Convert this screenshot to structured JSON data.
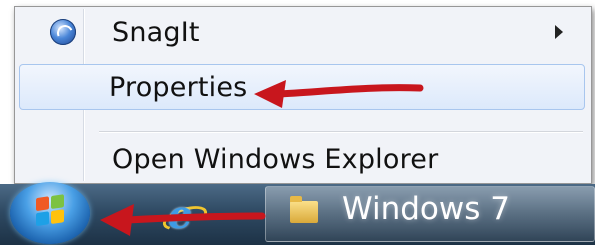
{
  "context_menu": {
    "items": [
      {
        "label": "SnagIt",
        "icon": "snagit-icon",
        "has_submenu": true
      },
      {
        "label": "Properties",
        "highlighted": true
      },
      {
        "label": "Open Windows Explorer"
      }
    ]
  },
  "taskbar": {
    "start_button_icon": "windows-start-orb",
    "pinned_ie_icon": "internet-explorer-icon",
    "window_button_icon": "folder-icon",
    "window_button_label": "Windows 7"
  },
  "annotations": {
    "arrow_color": "#c8161d",
    "arrows": [
      "pointing-to-properties",
      "pointing-to-start-button"
    ]
  },
  "colors": {
    "menu_bg": "#f1f3f8",
    "hover_border": "#a8c6ee",
    "taskbar": "#2f4a63"
  }
}
